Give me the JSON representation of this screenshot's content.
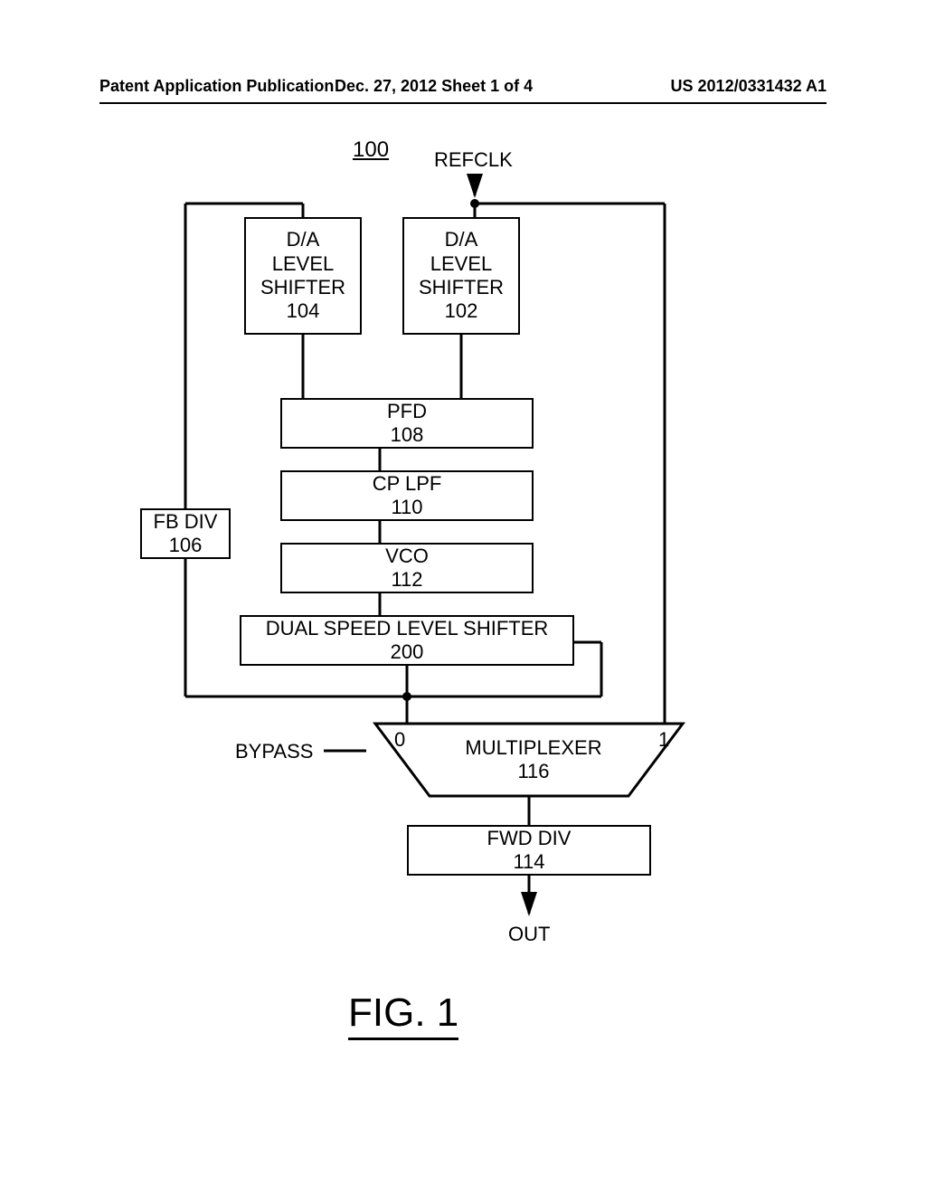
{
  "header": {
    "left": "Patent Application Publication",
    "center": "Dec. 27, 2012  Sheet 1 of 4",
    "right": "US 2012/0331432 A1"
  },
  "signals": {
    "refclk": "REFCLK",
    "bypass": "BYPASS",
    "out": "OUT"
  },
  "blocks": {
    "ref_num": "100",
    "level_shifter_left": {
      "line1": "D/A",
      "line2": "LEVEL",
      "line3": "SHIFTER",
      "num": "104"
    },
    "level_shifter_right": {
      "line1": "D/A",
      "line2": "LEVEL",
      "line3": "SHIFTER",
      "num": "102"
    },
    "fb_div": {
      "name": "FB DIV",
      "num": "106"
    },
    "pfd": {
      "name": "PFD",
      "num": "108"
    },
    "cp_lpf": {
      "name": "CP LPF",
      "num": "110"
    },
    "vco": {
      "name": "VCO",
      "num": "112"
    },
    "dual_ls": {
      "name": "DUAL SPEED LEVEL SHIFTER",
      "num": "200"
    },
    "mux": {
      "name": "MULTIPLEXER",
      "num": "116",
      "in0": "0",
      "in1": "1"
    },
    "fwd_div": {
      "name": "FWD DIV",
      "num": "114"
    }
  },
  "figure": "FIG. 1"
}
